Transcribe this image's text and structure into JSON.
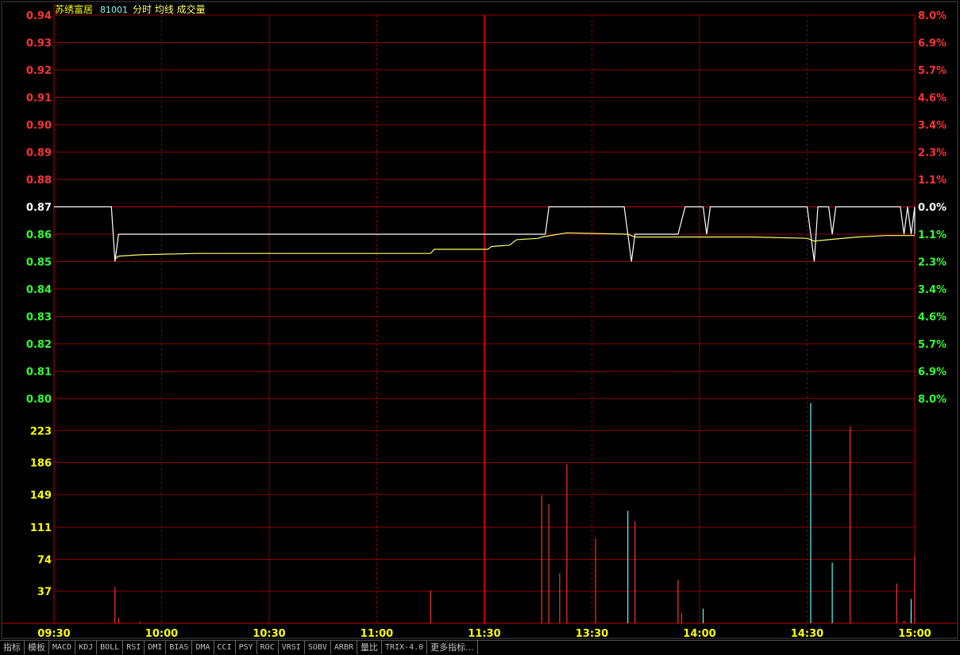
{
  "header": {
    "stock_name": "苏绣富居",
    "stock_code": "81001",
    "indicators": "分时 均线 成交量"
  },
  "colors": {
    "background": "#000000",
    "grid": "#8b0000",
    "frame": "#c00000",
    "price_line": "#ffffff",
    "avg_line": "#ffff66",
    "up_label": "#ff3333",
    "down_label": "#33ff33",
    "flat_label": "#ffffff",
    "volume_label": "#ffff00",
    "vol_up": "#ff3030",
    "vol_down": "#54ffff",
    "time_label": "#ffff00",
    "header_name": "#ffff00",
    "header_code": "#7fffff",
    "header_ind": "#ffff66"
  },
  "chart_data": {
    "type": "line",
    "prev_close": 0.87,
    "price_axis": {
      "ticks": [
        "0.94",
        "0.93",
        "0.92",
        "0.91",
        "0.90",
        "0.89",
        "0.88",
        "0.87",
        "0.86",
        "0.85",
        "0.84",
        "0.83",
        "0.82",
        "0.81",
        "0.80"
      ],
      "ylim": [
        0.8,
        0.94
      ]
    },
    "pct_axis": {
      "ticks": [
        "8.0%",
        "6.9%",
        "5.7%",
        "4.6%",
        "3.4%",
        "2.3%",
        "1.1%",
        "0.0%",
        "1.1%",
        "2.3%",
        "3.4%",
        "4.6%",
        "5.7%",
        "6.9%",
        "8.0%"
      ]
    },
    "volume_axis": {
      "ticks": [
        "223",
        "186",
        "149",
        "111",
        "74",
        "37"
      ],
      "ylim": [
        0,
        260
      ]
    },
    "time_axis": {
      "ticks": [
        "09:30",
        "10:00",
        "10:30",
        "11:00",
        "11:30",
        "13:30",
        "14:00",
        "14:30",
        "15:00"
      ],
      "xlim": [
        0,
        240
      ]
    },
    "series": [
      {
        "key": "price",
        "points": [
          [
            0,
            0.87
          ],
          [
            16,
            0.87
          ],
          [
            17,
            0.85
          ],
          [
            18,
            0.86
          ],
          [
            136,
            0.86
          ],
          [
            137,
            0.86
          ],
          [
            138,
            0.87
          ],
          [
            159,
            0.87
          ],
          [
            160,
            0.86
          ],
          [
            161,
            0.85
          ],
          [
            162,
            0.86
          ],
          [
            174,
            0.86
          ],
          [
            176,
            0.87
          ],
          [
            181,
            0.87
          ],
          [
            182,
            0.86
          ],
          [
            183,
            0.87
          ],
          [
            210,
            0.87
          ],
          [
            211,
            0.86
          ],
          [
            212,
            0.85
          ],
          [
            213,
            0.87
          ],
          [
            216,
            0.87
          ],
          [
            217,
            0.86
          ],
          [
            218,
            0.87
          ],
          [
            236,
            0.87
          ],
          [
            237,
            0.86
          ],
          [
            238,
            0.87
          ],
          [
            239,
            0.86
          ],
          [
            240,
            0.87
          ],
          [
            240,
            0.86
          ]
        ]
      },
      {
        "key": "average",
        "points": [
          [
            17,
            0.851
          ],
          [
            18,
            0.852
          ],
          [
            24,
            0.8525
          ],
          [
            40,
            0.853
          ],
          [
            105,
            0.853
          ],
          [
            106,
            0.8545
          ],
          [
            121,
            0.8545
          ],
          [
            122,
            0.8555
          ],
          [
            127,
            0.856
          ],
          [
            129,
            0.858
          ],
          [
            135,
            0.8585
          ],
          [
            136,
            0.859
          ],
          [
            143,
            0.8605
          ],
          [
            160,
            0.86
          ],
          [
            162,
            0.859
          ],
          [
            178,
            0.859
          ],
          [
            183,
            0.859
          ],
          [
            195,
            0.859
          ],
          [
            210,
            0.8585
          ],
          [
            212,
            0.8575
          ],
          [
            216,
            0.858
          ],
          [
            224,
            0.859
          ],
          [
            232,
            0.8595
          ],
          [
            240,
            0.8595
          ]
        ]
      }
    ],
    "volume": [
      [
        17,
        42,
        "up"
      ],
      [
        18,
        6,
        "up"
      ],
      [
        24,
        2,
        "up"
      ],
      [
        105,
        38,
        "up"
      ],
      [
        136,
        148,
        "up"
      ],
      [
        138,
        138,
        "up"
      ],
      [
        141,
        58,
        "up"
      ],
      [
        143,
        184,
        "up"
      ],
      [
        151,
        98,
        "up"
      ],
      [
        160,
        130,
        "down"
      ],
      [
        162,
        118,
        "up"
      ],
      [
        174,
        50,
        "up"
      ],
      [
        175,
        12,
        "up"
      ],
      [
        181,
        17,
        "down"
      ],
      [
        211,
        255,
        "down"
      ],
      [
        217,
        70,
        "down"
      ],
      [
        222,
        228,
        "up"
      ],
      [
        235,
        46,
        "up"
      ],
      [
        239,
        28,
        "down"
      ],
      [
        240,
        78,
        "up"
      ],
      [
        237,
        3,
        "up"
      ],
      [
        239,
        14,
        "down"
      ]
    ]
  },
  "tabs": [
    "指标",
    "模板",
    "MACD",
    "KDJ",
    "BOLL",
    "RSI",
    "DMI",
    "BIAS",
    "DMA",
    "CCI",
    "PSY",
    "ROC",
    "VRSI",
    "SOBV",
    "ARBR",
    "量比",
    "TRIX-4.0",
    "更多指标..."
  ]
}
